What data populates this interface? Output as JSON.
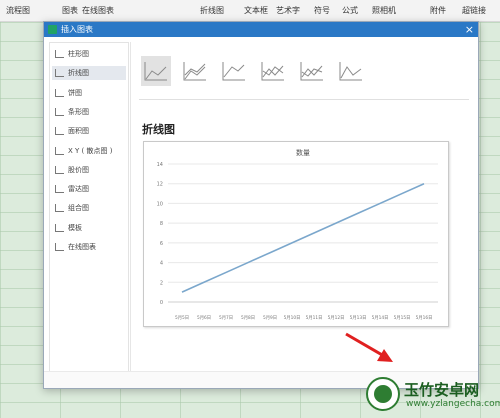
{
  "ribbon": {
    "items": [
      "流程图",
      "图表",
      "在线图表",
      "折线图",
      "文本框",
      "艺术字",
      "符号",
      "公式",
      "照相机",
      "附件",
      "超链接"
    ]
  },
  "dialog": {
    "title": "插入图表",
    "close_label": "×"
  },
  "sidebar": {
    "items": [
      {
        "label": "柱形图",
        "icon": "bar-chart-icon"
      },
      {
        "label": "折线图",
        "icon": "line-chart-icon"
      },
      {
        "label": "饼图",
        "icon": "pie-chart-icon"
      },
      {
        "label": "条形图",
        "icon": "horizontal-bar-icon"
      },
      {
        "label": "面积图",
        "icon": "area-chart-icon"
      },
      {
        "label": "X Y ( 散点图 )",
        "icon": "scatter-chart-icon"
      },
      {
        "label": "股价图",
        "icon": "stock-chart-icon"
      },
      {
        "label": "雷达图",
        "icon": "radar-chart-icon"
      },
      {
        "label": "组合图",
        "icon": "combo-chart-icon"
      },
      {
        "label": "模板",
        "icon": "template-icon"
      },
      {
        "label": "在线图表",
        "icon": "online-chart-icon"
      }
    ],
    "active_index": 1
  },
  "content": {
    "chart_type_title": "折线图",
    "selected_variant_index": 0
  },
  "chart_data": {
    "type": "line",
    "title": "数量",
    "categories": [
      "5月5日",
      "5月6日",
      "5月7日",
      "5月8日",
      "5月9日",
      "5月10日",
      "5月11日",
      "5月12日",
      "5月13日",
      "5月14日",
      "5月15日",
      "5月16日"
    ],
    "series": [
      {
        "values": [
          1,
          2,
          3,
          4,
          5,
          6,
          7,
          8,
          9,
          10,
          11,
          12
        ],
        "color": "#7ba7cc"
      }
    ],
    "ylim": [
      0,
      14
    ],
    "yticks": [
      0,
      2,
      4,
      6,
      8,
      10,
      12,
      14
    ],
    "grid": true
  },
  "watermark": {
    "name": "玉竹安卓网",
    "url": "www.yzlangecha.com"
  }
}
